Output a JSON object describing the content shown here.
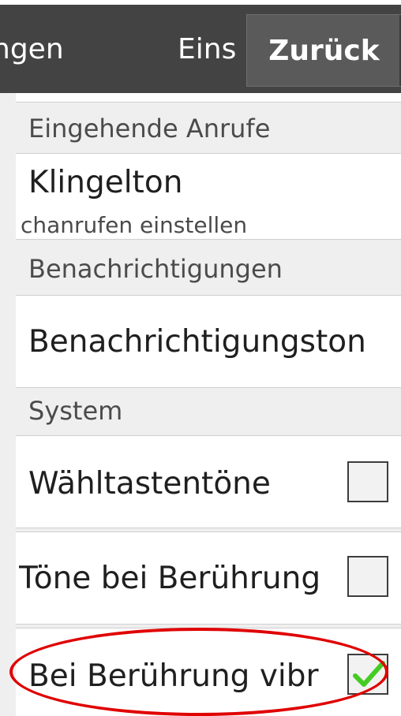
{
  "action_bar": {
    "title_left": "ngen",
    "title_right": "Eins",
    "back_label": "Zurück"
  },
  "sections": {
    "incoming_calls": "Eingehende Anrufe",
    "notifications": "Benachrichtigungen",
    "system": "System"
  },
  "ringtone": {
    "title": "Klingelton",
    "summary": "chanrufen einstellen"
  },
  "notification_sound": {
    "title": "Benachrichtigungston"
  },
  "dial_tones": {
    "title": "Wähltastentöne",
    "checked": false
  },
  "touch_sounds": {
    "title": "Töne bei Berührung",
    "checked": false
  },
  "haptic_feedback": {
    "title": "Bei Berührung vibr",
    "checked": true
  },
  "colors": {
    "action_bar": "#434343",
    "highlight": "#e00000",
    "checkmark": "#44cc22"
  }
}
